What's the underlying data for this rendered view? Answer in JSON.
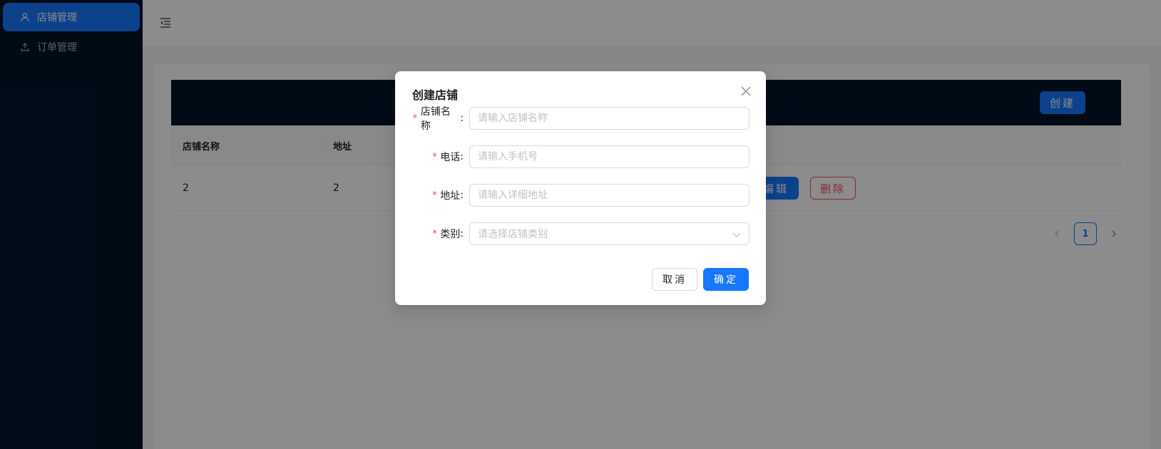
{
  "sidebar": {
    "items": [
      {
        "label": "店铺管理",
        "icon": "user-icon",
        "active": true
      },
      {
        "label": "订单管理",
        "icon": "upload-icon",
        "active": false
      }
    ]
  },
  "header": {
    "toggle_icon": "menu-fold-icon"
  },
  "toolbar": {
    "create_label": "创建"
  },
  "table": {
    "columns": [
      "店铺名称",
      "地址"
    ],
    "rows": [
      {
        "name": "2",
        "address": "2",
        "edit_label": "编辑",
        "delete_label": "删除"
      }
    ]
  },
  "pagination": {
    "current": "1",
    "prev_icon": "left-icon",
    "next_icon": "right-icon"
  },
  "modal": {
    "title": "创建店铺",
    "close_icon": "close-icon",
    "fields": {
      "name": {
        "label": "店铺名称",
        "placeholder": "请输入店铺名称",
        "value": ""
      },
      "phone": {
        "label": "电话",
        "placeholder": "请输入手机号",
        "value": ""
      },
      "address": {
        "label": "地址",
        "placeholder": "请输入详细地址",
        "value": ""
      },
      "category": {
        "label": "类别",
        "placeholder": "请选择店铺类别",
        "value": ""
      }
    },
    "required_mark": "*",
    "colon": ":",
    "cancel_label": "取消",
    "ok_label": "确定"
  },
  "colors": {
    "primary": "#1677ff",
    "danger": "#ff4d4f",
    "sider": "#001529"
  }
}
